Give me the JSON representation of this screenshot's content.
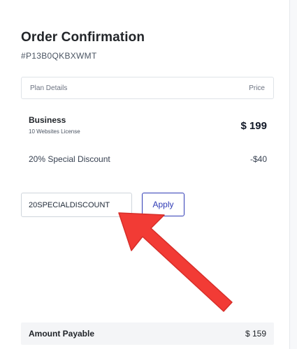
{
  "order": {
    "title": "Order Confirmation",
    "id": "#P13B0QKBXWMT"
  },
  "table": {
    "col_plan": "Plan Details",
    "col_price": "Price"
  },
  "plan": {
    "name": "Business",
    "license": "10 Websites License",
    "price": "$ 199"
  },
  "discount": {
    "label": "20% Special Discount",
    "value": "-$40"
  },
  "coupon": {
    "value": "20SPECIALDISCOUNT",
    "apply_label": "Apply"
  },
  "payable": {
    "label": "Amount Payable",
    "value": "$ 159"
  },
  "annotation": {
    "arrow_icon": "red-arrow-icon",
    "arrow_color": "#f23b35"
  },
  "colors": {
    "accent": "#2f3bb5",
    "border": "#dfe3e8",
    "payable_bg": "#f4f5f7"
  }
}
